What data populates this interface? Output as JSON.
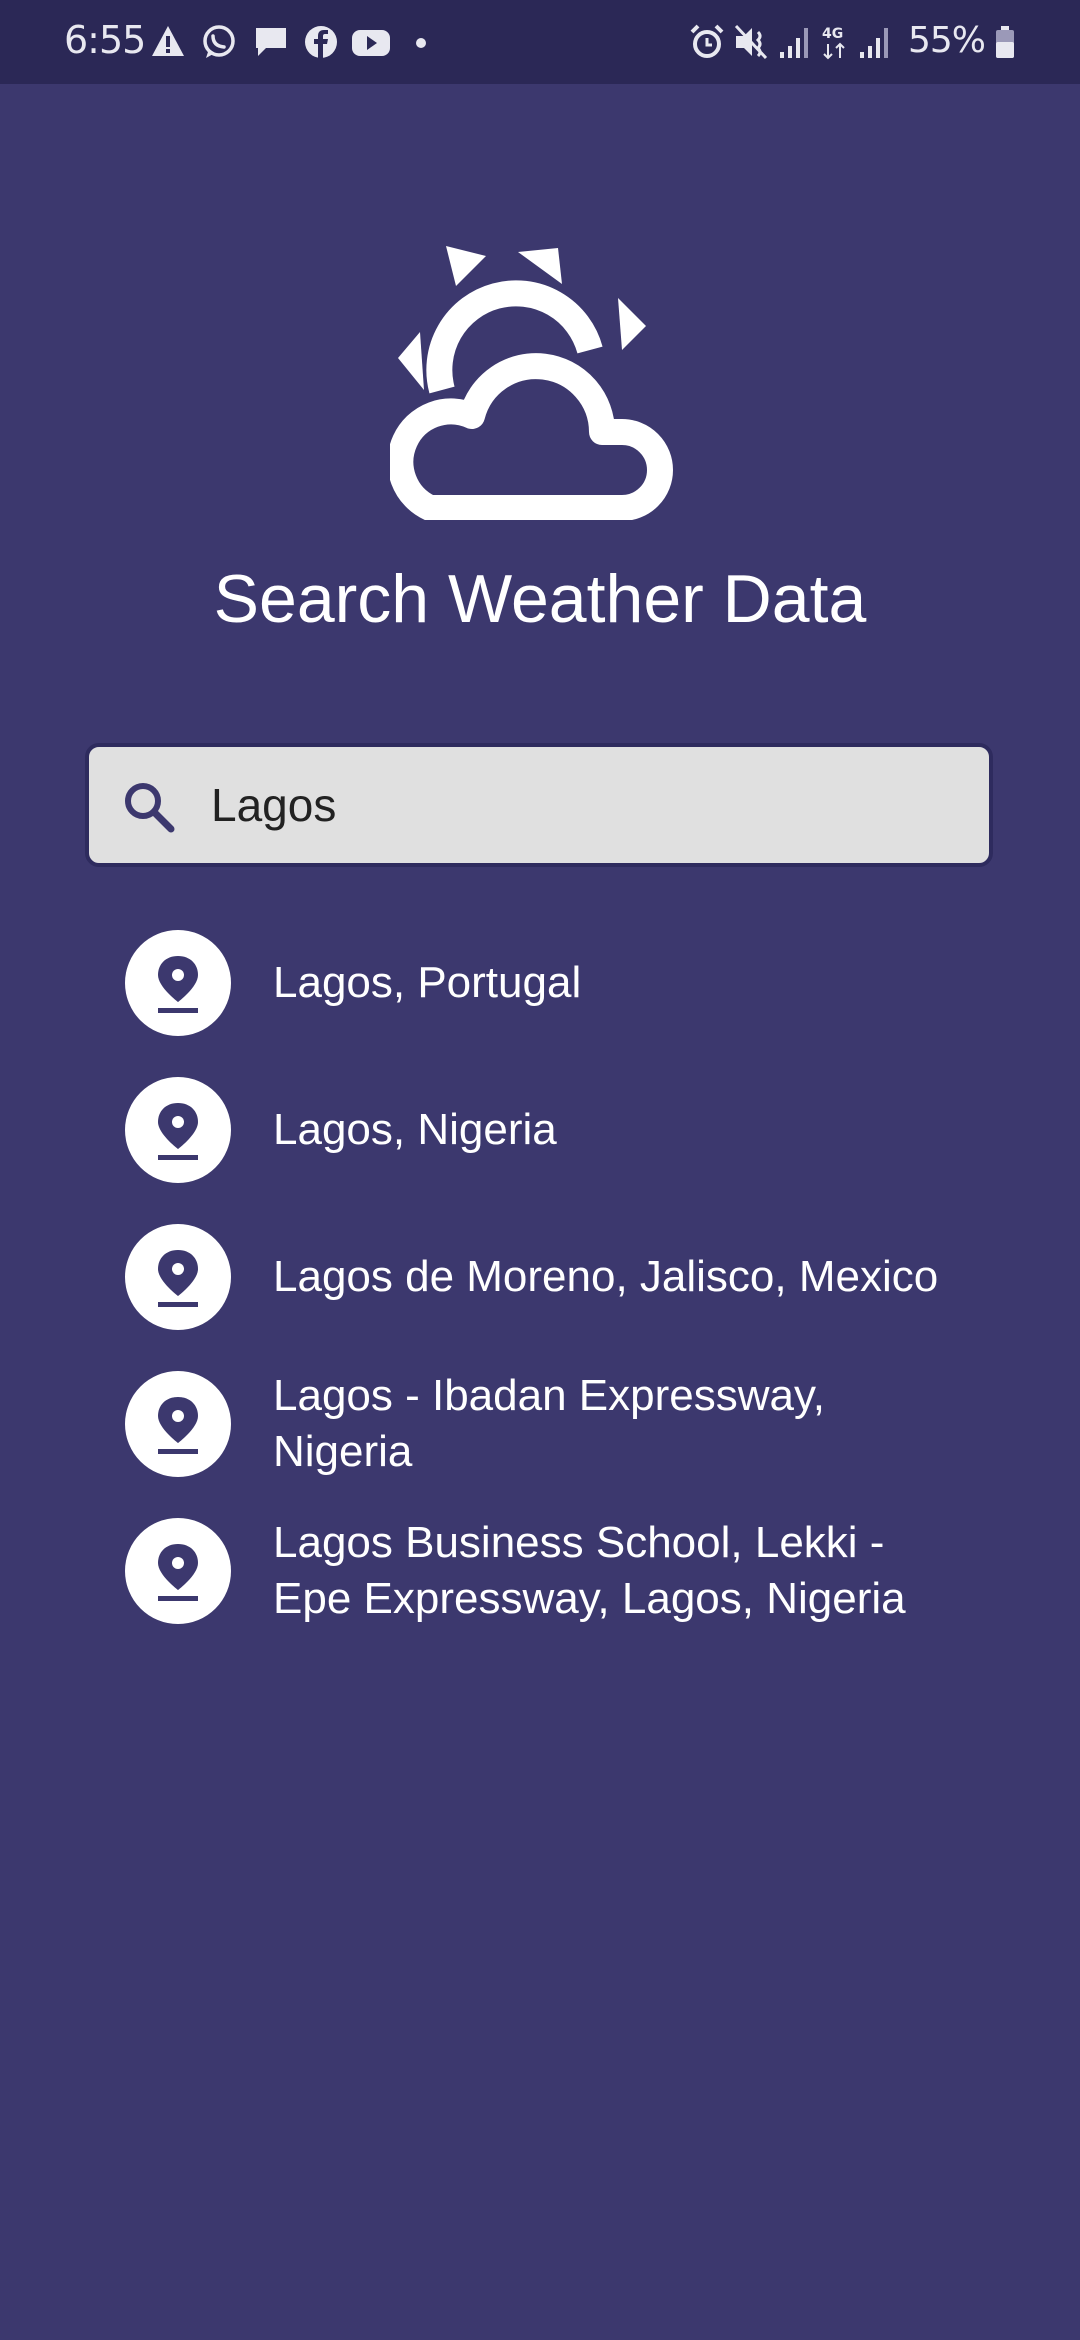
{
  "status_bar": {
    "time": "6:55",
    "battery_percent": "55%",
    "icons": [
      "alert-icon",
      "whatsapp-icon",
      "message-icon",
      "facebook-icon",
      "youtube-icon",
      "dot-icon",
      "alarm-icon",
      "vibrate-icon",
      "signal-icon",
      "network-4g-icon",
      "signal-icon",
      "battery-icon"
    ]
  },
  "header": {
    "logo_icon": "sun-cloud-icon",
    "title": "Search Weather Data"
  },
  "search": {
    "icon": "search-icon",
    "value": "Lagos"
  },
  "results": [
    {
      "icon": "location-pin-icon",
      "label": "Lagos, Portugal"
    },
    {
      "icon": "location-pin-icon",
      "label": "Lagos, Nigeria"
    },
    {
      "icon": "location-pin-icon",
      "label": "Lagos de Moreno, Jalisco, Mexico"
    },
    {
      "icon": "location-pin-icon",
      "label": "Lagos - Ibadan Expressway, Nigeria"
    },
    {
      "icon": "location-pin-icon",
      "label": "Lagos Business School, Lekki - Epe Expressway, Lagos, Nigeria"
    }
  ],
  "colors": {
    "background": "#3c386e",
    "status_bar": "#2b2856",
    "search_field": "#e0e0e0",
    "accent": "#3c386e"
  }
}
